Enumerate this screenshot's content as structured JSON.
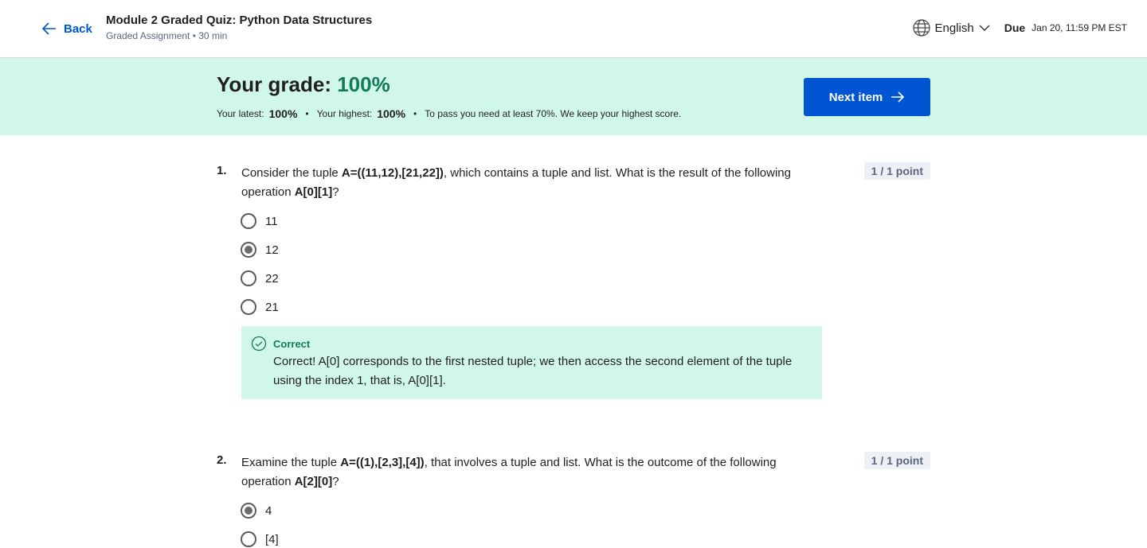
{
  "header": {
    "back_label": "Back",
    "title": "Module 2 Graded Quiz: Python Data Structures",
    "subtitle": "Graded Assignment • 30 min",
    "language": "English",
    "due_label": "Due",
    "due_value": "Jan 20, 11:59 PM EST"
  },
  "banner": {
    "grade_label": "Your grade:",
    "grade_value": "100%",
    "latest_label": "Your latest:",
    "latest_value": "100%",
    "highest_label": "Your highest:",
    "highest_value": "100%",
    "separator": "•",
    "pass_note": "To pass you need at least 70%. We keep your highest score.",
    "next_button": "Next item"
  },
  "questions": [
    {
      "number": "1.",
      "text_before": "Consider the tuple ",
      "code1": "A=((11,12),[21,22])",
      "text_mid": ", which contains a tuple and list. What is the result of the following operation ",
      "code2": "A[0][1]",
      "text_after": "?",
      "points": "1 / 1 point",
      "options": [
        "11",
        "12",
        "22",
        "21"
      ],
      "selected_index": 1,
      "feedback": {
        "status": "Correct",
        "text": "Correct! A[0] corresponds to the first nested tuple; we then access the second element of the tuple using the index 1, that is, A[0][1]."
      }
    },
    {
      "number": "2.",
      "text_before": "Examine the tuple ",
      "code1": "A=((1),[2,3],[4])",
      "text_mid": ", that involves a tuple and list. What is the outcome of the following operation ",
      "code2": "A[2][0]",
      "text_after": "?",
      "points": "1 / 1 point",
      "options": [
        "4",
        "[4]"
      ],
      "selected_index": 0
    }
  ],
  "colors": {
    "accent": "#0056d2",
    "success": "#137a5c",
    "success_bg": "#d0f7ea"
  }
}
